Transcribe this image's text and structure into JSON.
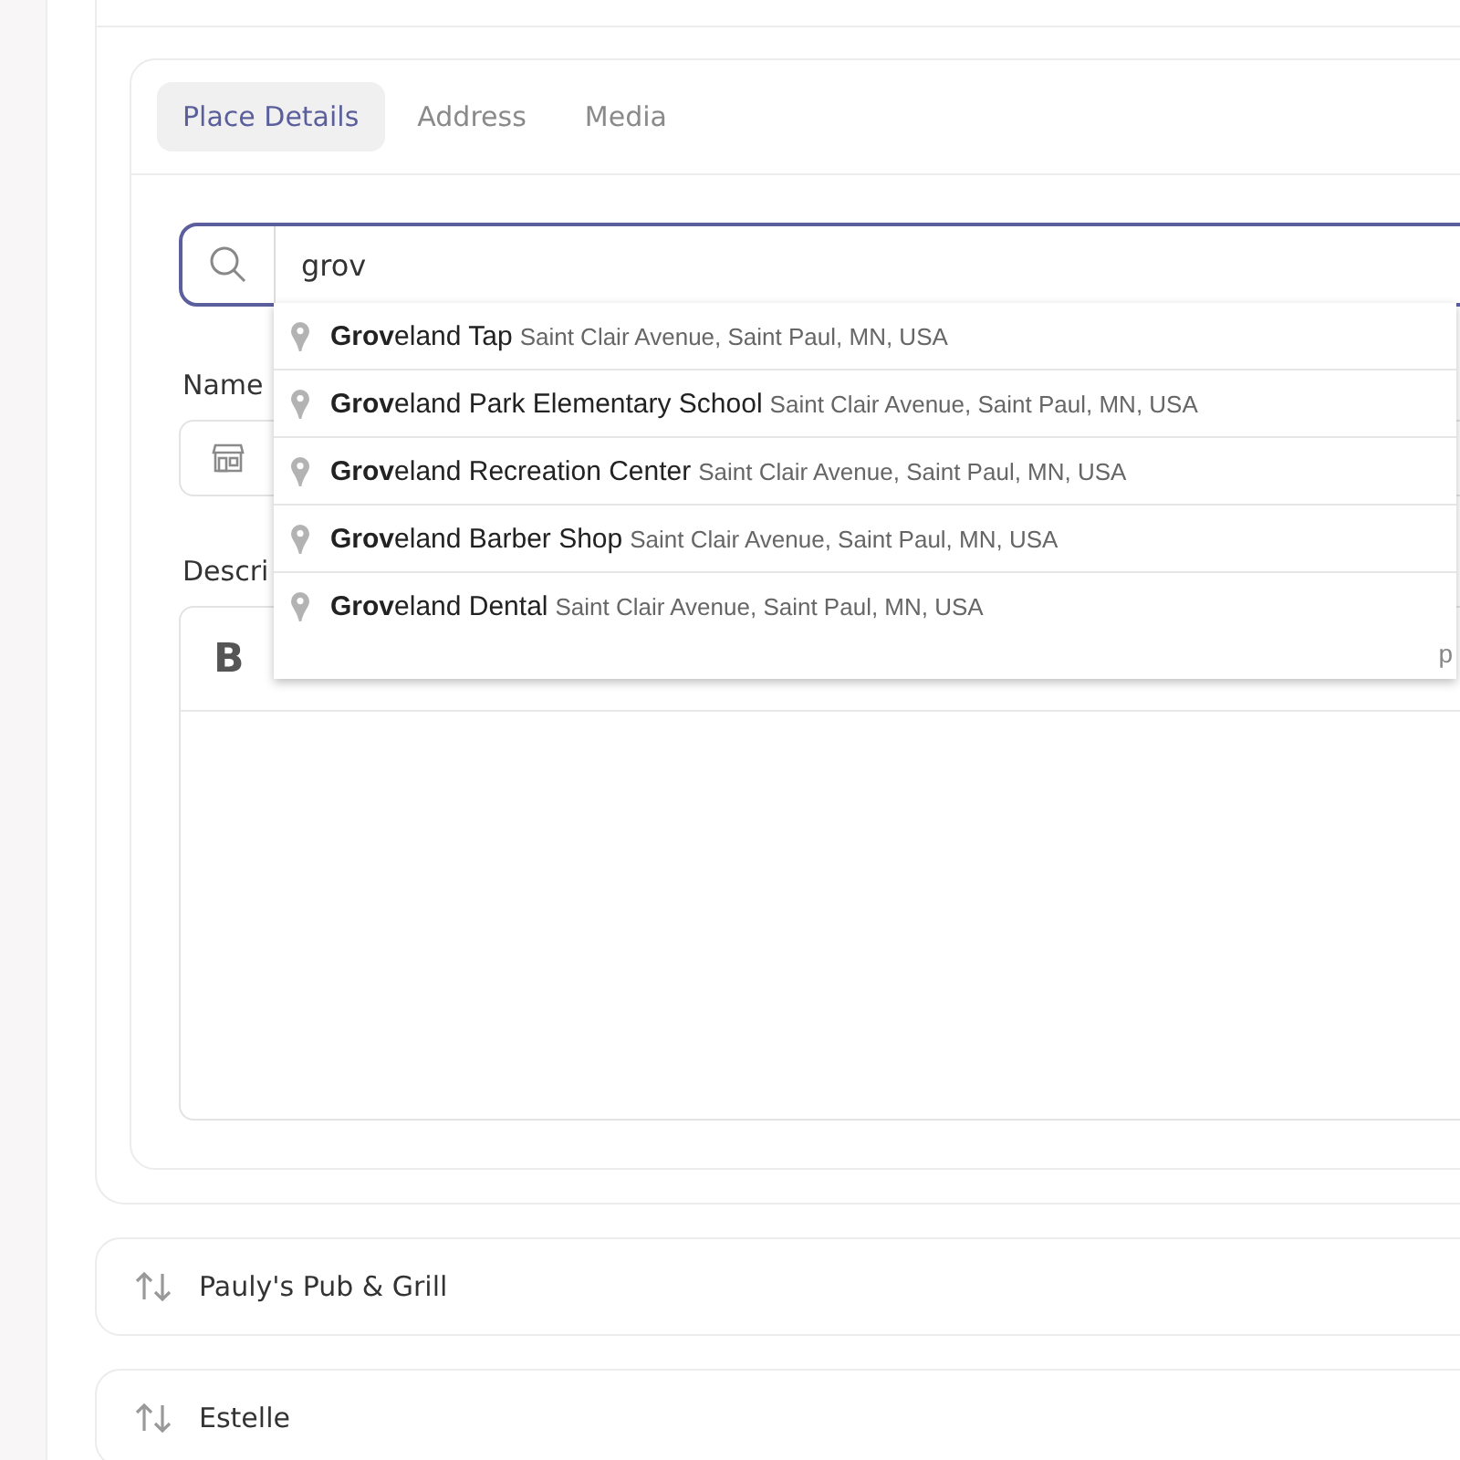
{
  "tabs": [
    {
      "label": "Place Details",
      "selected": true
    },
    {
      "label": "Address",
      "selected": false
    },
    {
      "label": "Media",
      "selected": false
    }
  ],
  "search": {
    "value": "grov"
  },
  "suggestions": [
    {
      "name": "**Grov**eland Tap",
      "address": "Saint Clair Avenue, Saint Paul, MN, USA"
    },
    {
      "name": "**Grov**eland Park Elementary School",
      "address": "Saint Clair Avenue, Saint Paul, MN, USA"
    },
    {
      "name": "**Grov**eland Recreation Center",
      "address": "Saint Clair Avenue, Saint Paul, MN, USA"
    },
    {
      "name": "**Grov**eland Barber Shop",
      "address": "Saint Clair Avenue, Saint Paul, MN, USA"
    },
    {
      "name": "**Grov**eland Dental",
      "address": "Saint Clair Avenue, Saint Paul, MN, USA"
    }
  ],
  "suggestions_footer": "p",
  "name_field": {
    "label": "Name"
  },
  "description": {
    "label": "Descri",
    "toolbar": [
      "B"
    ]
  },
  "places": [
    {
      "name": "Pauly's Pub & Grill"
    },
    {
      "name": "Estelle"
    }
  ]
}
